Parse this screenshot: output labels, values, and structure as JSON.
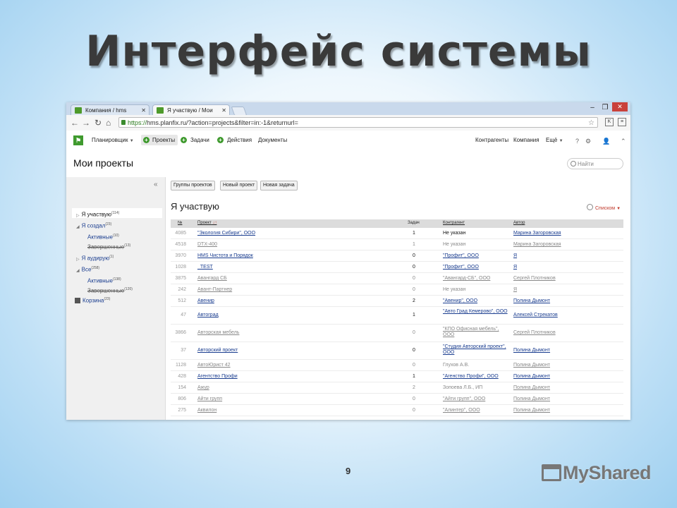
{
  "slide": {
    "title": "Интерфейс системы",
    "page_number": "9",
    "logo": "MyShared"
  },
  "browser": {
    "tabs": [
      {
        "label": "Компания / hms"
      },
      {
        "label": "Я участвую / Мои проекты"
      }
    ],
    "url_scheme": "https://",
    "url_rest": "hms.planfix.ru/?action=projects&filter=in:-1&returnurl="
  },
  "app": {
    "menu": {
      "planner": "Планировщик",
      "projects": "Проекты",
      "tasks": "Задачи",
      "actions": "Действия",
      "documents": "Документы",
      "contractors": "Контрагенты",
      "company": "Компания",
      "more": "Ещё"
    },
    "page_title": "Мои проекты",
    "search_placeholder": "Найти",
    "sidebar": {
      "items": [
        {
          "label": "Я участвую",
          "count": "(114)"
        },
        {
          "label": "Я создал",
          "count": "(23)"
        },
        {
          "label": "Активные",
          "count": "(10)"
        },
        {
          "label": "Завершенные",
          "count": "(13)"
        },
        {
          "label": "Я аудирую",
          "count": "(1)"
        },
        {
          "label": "Все",
          "count": "(258)"
        },
        {
          "label": "Активные",
          "count": "(138)"
        },
        {
          "label": "Завершенные",
          "count": "(120)"
        },
        {
          "label": "Корзина",
          "count": "(23)"
        }
      ]
    },
    "buttons": {
      "groups": "Группы проектов",
      "new_project": "Новый проект",
      "new_task": "Новая задача"
    },
    "section_title": "Я участвую",
    "view_mode": "Списком",
    "table": {
      "headers": {
        "num": "№",
        "project": "Проект",
        "tasks": "Задач",
        "contractor": "Контрагент",
        "author": "Автор"
      },
      "rows": [
        {
          "num": "4085",
          "name": "\"Экология Сибири\", ООО",
          "tasks": "1",
          "contractor": "Не указан",
          "author": "Марина Загоровская",
          "active": true
        },
        {
          "num": "4518",
          "name": "DTX-400",
          "tasks": "1",
          "contractor": "Не указан",
          "author": "Марина Загоровская",
          "active": false
        },
        {
          "num": "3970",
          "name": "HMS Чистота и Порядок",
          "tasks": "0",
          "contractor": "\"Профит\", ООО",
          "author": "Я",
          "active": true
        },
        {
          "num": "1028",
          "name": "_TEST",
          "tasks": "0",
          "contractor": "\"Профит\", ООО",
          "author": "Я",
          "active": true
        },
        {
          "num": "3875",
          "name": "Авангард СБ",
          "tasks": "0",
          "contractor": "\"Авангард-СБ\", ООО",
          "author": "Сергей Плотников",
          "active": false
        },
        {
          "num": "242",
          "name": "Авант-Партнер",
          "tasks": "0",
          "contractor": "Не указан",
          "author": "Я",
          "active": false
        },
        {
          "num": "512",
          "name": "Авенир",
          "tasks": "2",
          "contractor": "\"Авенир\", ООО",
          "author": "Полина Дымонт",
          "active": true
        },
        {
          "num": "47",
          "name": "Автоград",
          "tasks": "1",
          "contractor": "\"Авто Град Кемерово\", ООО",
          "author": "Алексей Стрекатов",
          "active": true
        },
        {
          "num": "3866",
          "name": "Авторская мебель",
          "tasks": "0",
          "contractor": "\"КПО Офисная мебель\", ООО",
          "author": "Сергей Плотников",
          "active": false
        },
        {
          "num": "37",
          "name": "Авторский проект",
          "tasks": "0",
          "contractor": "\"Студия Авторский проект\", ООО",
          "author": "Полина Дымонт",
          "active": true
        },
        {
          "num": "1128",
          "name": "АвтоЮрист 42",
          "tasks": "0",
          "contractor": "Глухов А.В.",
          "author": "Полина Дымонт",
          "active": false
        },
        {
          "num": "428",
          "name": "Агентство Профи",
          "tasks": "1",
          "contractor": "\"Агенство Профи\", ООО",
          "author": "Полина Дымонт",
          "active": true
        },
        {
          "num": "154",
          "name": "Ажур",
          "tasks": "2",
          "contractor": "Зопоева Л.Б., ИП",
          "author": "Полина Дымонт",
          "active": false
        },
        {
          "num": "806",
          "name": "Айти групп",
          "tasks": "0",
          "contractor": "\"Айти групп\", ООО",
          "author": "Полина Дымонт",
          "active": false
        },
        {
          "num": "275",
          "name": "Аквилон",
          "tasks": "0",
          "contractor": "\"Алинтер\", ООО",
          "author": "Полина Дымонт",
          "active": false
        }
      ]
    }
  },
  "colors": {
    "accent_green": "#3f9a2e",
    "link_blue": "#1a3d8f",
    "view_red": "#c0392b"
  }
}
